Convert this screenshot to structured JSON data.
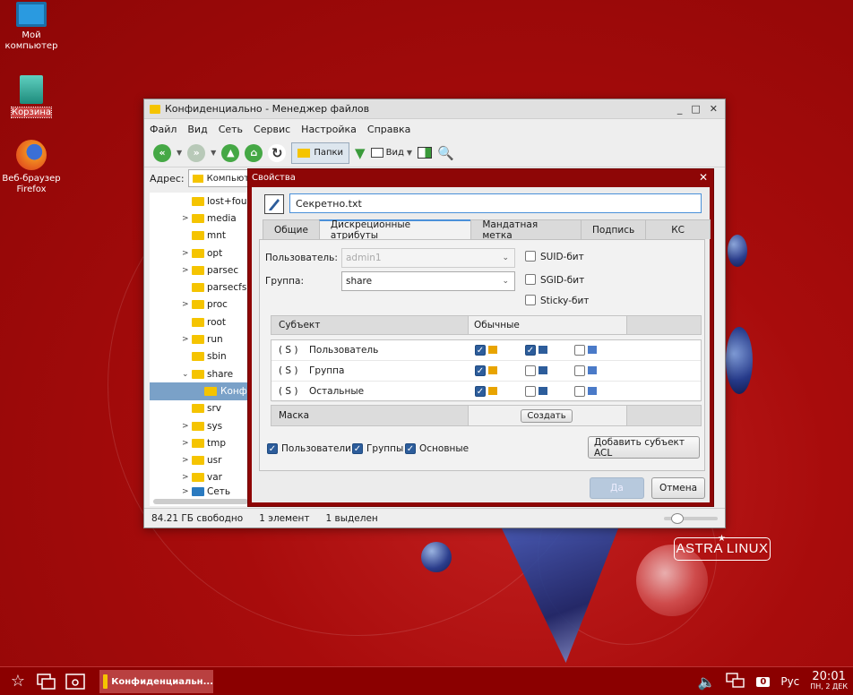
{
  "desktop": {
    "icons": [
      {
        "name": "my-computer",
        "label": "Мой компьютер"
      },
      {
        "name": "trash",
        "label": "Корзина"
      },
      {
        "name": "firefox",
        "label": "Веб-браузер Firefox"
      }
    ],
    "logo": "ASTRA LINUX"
  },
  "file_manager": {
    "title": "Конфиденциально - Менеджер файлов",
    "menu": [
      "Файл",
      "Вид",
      "Сеть",
      "Сервис",
      "Настройка",
      "Справка"
    ],
    "toolbar": {
      "folders_label": "Папки",
      "view_label": "Вид"
    },
    "address_label": "Адрес:",
    "address_value": "Компьюте",
    "tree": [
      {
        "label": "lost+foun",
        "arrow": ""
      },
      {
        "label": "media",
        "arrow": ">"
      },
      {
        "label": "mnt",
        "arrow": ""
      },
      {
        "label": "opt",
        "arrow": ">"
      },
      {
        "label": "parsec",
        "arrow": ">"
      },
      {
        "label": "parsecfs",
        "arrow": ""
      },
      {
        "label": "proc",
        "arrow": ">"
      },
      {
        "label": "root",
        "arrow": ""
      },
      {
        "label": "run",
        "arrow": ">"
      },
      {
        "label": "sbin",
        "arrow": ""
      },
      {
        "label": "share",
        "arrow": "v"
      },
      {
        "label": "Конфи",
        "arrow": ""
      },
      {
        "label": "srv",
        "arrow": ""
      },
      {
        "label": "sys",
        "arrow": ">"
      },
      {
        "label": "tmp",
        "arrow": ">"
      },
      {
        "label": "usr",
        "arrow": ">"
      },
      {
        "label": "var",
        "arrow": ">"
      },
      {
        "label": "Сеть",
        "arrow": ">"
      }
    ],
    "status": {
      "free": "84.21 ГБ свободно",
      "count": "1 элемент",
      "selected": "1 выделен"
    }
  },
  "dialog": {
    "title": "Свойства",
    "file_name": "Секретно.txt",
    "tabs": [
      "Общие",
      "Дискреционные атрибуты",
      "Мандатная метка",
      "Подпись",
      "КС"
    ],
    "user_label": "Пользователь:",
    "user_value": "admin1",
    "group_label": "Группа:",
    "group_value": "share",
    "suid": "SUID-бит",
    "sgid": "SGID-бит",
    "sticky": "Sticky-бит",
    "acl_head": {
      "subject": "Субъект",
      "normal": "Обычные"
    },
    "acl_rows": [
      {
        "tag": "( S )",
        "name": "Пользователь",
        "r": true,
        "w": true,
        "x": false
      },
      {
        "tag": "( S )",
        "name": "Группа",
        "r": true,
        "w": false,
        "x": false
      },
      {
        "tag": "( S )",
        "name": "Остальные",
        "r": true,
        "w": false,
        "x": false
      }
    ],
    "mask_label": "Маска",
    "create_btn": "Создать",
    "filter": {
      "users": "Пользователи",
      "groups": "Группы",
      "basic": "Основные"
    },
    "add_acl_btn": "Добавить субъект ACL",
    "ok_btn": "Да",
    "cancel_btn": "Отмена"
  },
  "taskbar": {
    "task_label": "Конфиденциальн...",
    "kbd_count": "0",
    "lang": "Рус",
    "time": "20:01",
    "date": "ПН, 2 ДЕК"
  }
}
